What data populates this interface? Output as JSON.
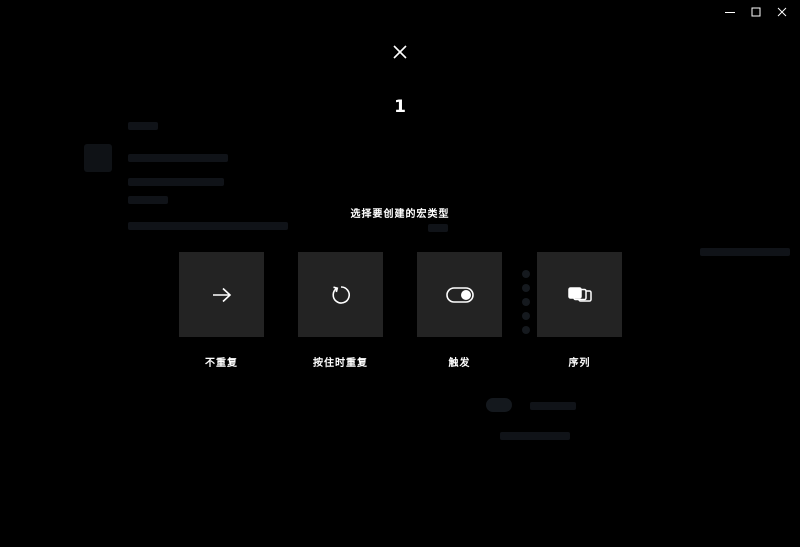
{
  "window": {
    "controls": [
      "minimize-icon",
      "maximize-icon",
      "close-icon"
    ]
  },
  "dialog": {
    "close_icon": "close-icon",
    "step": "1",
    "prompt": "选择要创建的宏类型",
    "options": [
      {
        "label": "不重复",
        "icon": "arrow-right-icon"
      },
      {
        "label": "按住时重复",
        "icon": "repeat-icon"
      },
      {
        "label": "触发",
        "icon": "toggle-icon"
      },
      {
        "label": "序列",
        "icon": "sequence-icon"
      }
    ]
  },
  "colors": {
    "background": "#000000",
    "tile": "#232323",
    "text": "#ffffff"
  }
}
